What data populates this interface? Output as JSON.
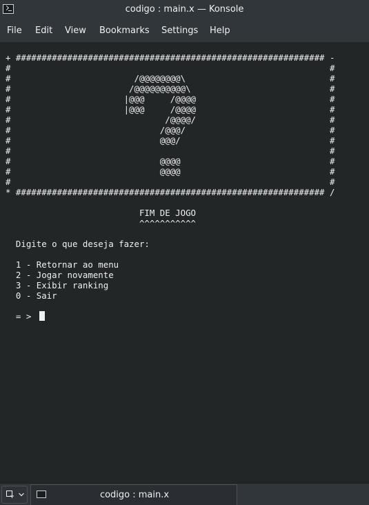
{
  "window": {
    "title": "codigo : main.x — Konsole",
    "icon": "terminal-icon"
  },
  "menu": [
    "File",
    "Edit",
    "View",
    "Bookmarks",
    "Settings",
    "Help"
  ],
  "terminal": {
    "lines": [
      "+ ############################################################ -",
      "#                                                              #",
      "#                        /@@@@@@@@\\                            #",
      "#                       /@@@@@@@@@@\\                           #",
      "#                      |@@@     /@@@@                          #",
      "#                      |@@@     /@@@@                          #",
      "#                              /@@@@/                          #",
      "#                             /@@@/                            #",
      "#                             @@@/                             #",
      "#                                                              #",
      "#                             @@@@                             #",
      "#                             @@@@                             #",
      "#                                                              #",
      "* ############################################################ /",
      "",
      "                          FIM DE JOGO",
      "                          ^^^^^^^^^^^",
      "",
      "  Digite o que deseja fazer:",
      "",
      "  1 - Retornar ao menu",
      "  2 - Jogar novamente",
      "  3 - Exibir ranking",
      "  0 - Sair",
      "",
      "  = > "
    ]
  },
  "tabs": {
    "new_tab_icon": "new-tab-icon",
    "dropdown_icon": "chevron-down-icon",
    "active": {
      "label": "codigo : main.x",
      "icon": "terminal-icon"
    }
  }
}
